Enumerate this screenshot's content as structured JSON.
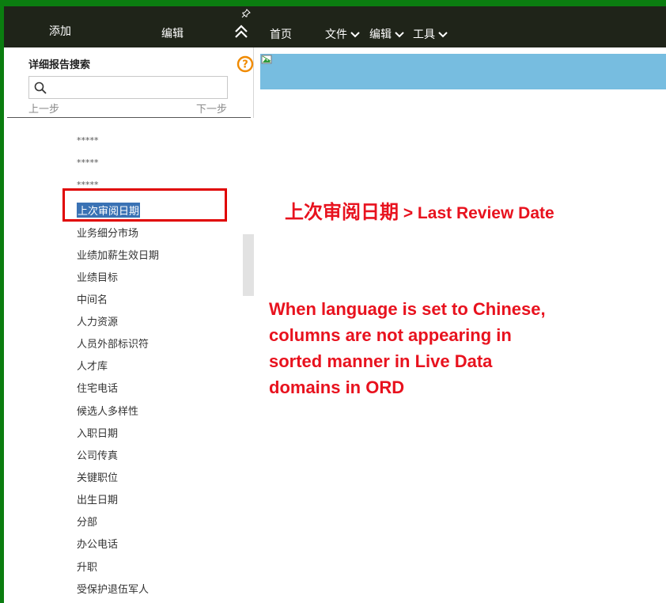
{
  "left_panel": {
    "tab_add": "添加",
    "tab_edit": "编辑",
    "search_label": "详细报告搜索",
    "search_value": "",
    "prev_step": "上一步",
    "next_step": "下一步",
    "fields": [
      {
        "label": "*****"
      },
      {
        "label": "*****"
      },
      {
        "label": "*****"
      },
      {
        "label": "上次审阅日期",
        "selected": true
      },
      {
        "label": "业务细分市场"
      },
      {
        "label": "业绩加薪生效日期"
      },
      {
        "label": "业绩目标"
      },
      {
        "label": "中间名"
      },
      {
        "label": "人力资源"
      },
      {
        "label": "人员外部标识符"
      },
      {
        "label": "人才库"
      },
      {
        "label": "住宅电话"
      },
      {
        "label": "候选人多样性"
      },
      {
        "label": "入职日期"
      },
      {
        "label": "公司传真"
      },
      {
        "label": "关键职位"
      },
      {
        "label": "出生日期"
      },
      {
        "label": "分部"
      },
      {
        "label": "办公电话"
      },
      {
        "label": "升职"
      },
      {
        "label": "受保护退伍军人"
      }
    ]
  },
  "topbar": {
    "home": "首页",
    "file": "文件",
    "edit": "编辑",
    "tools": "工具"
  },
  "annotation": {
    "title_zh": "上次审阅日期",
    "title_en": " > Last Review Date",
    "body_lines": [
      "When language is set to Chinese,",
      "columns are not appearing in",
      "sorted manner in Live Data",
      "domains in ORD"
    ]
  },
  "colors": {
    "frame_green": "#0b7d10",
    "header_dark": "#1f2419",
    "annotation_red": "#e8121e",
    "band_blue": "#77bde0",
    "help_orange": "#f08a00",
    "selection_blue": "#3a72b4"
  },
  "icons": [
    "pin-icon",
    "collapse-up-icon",
    "help-icon",
    "search-icon",
    "chevron-down-icon",
    "broken-image-icon"
  ]
}
